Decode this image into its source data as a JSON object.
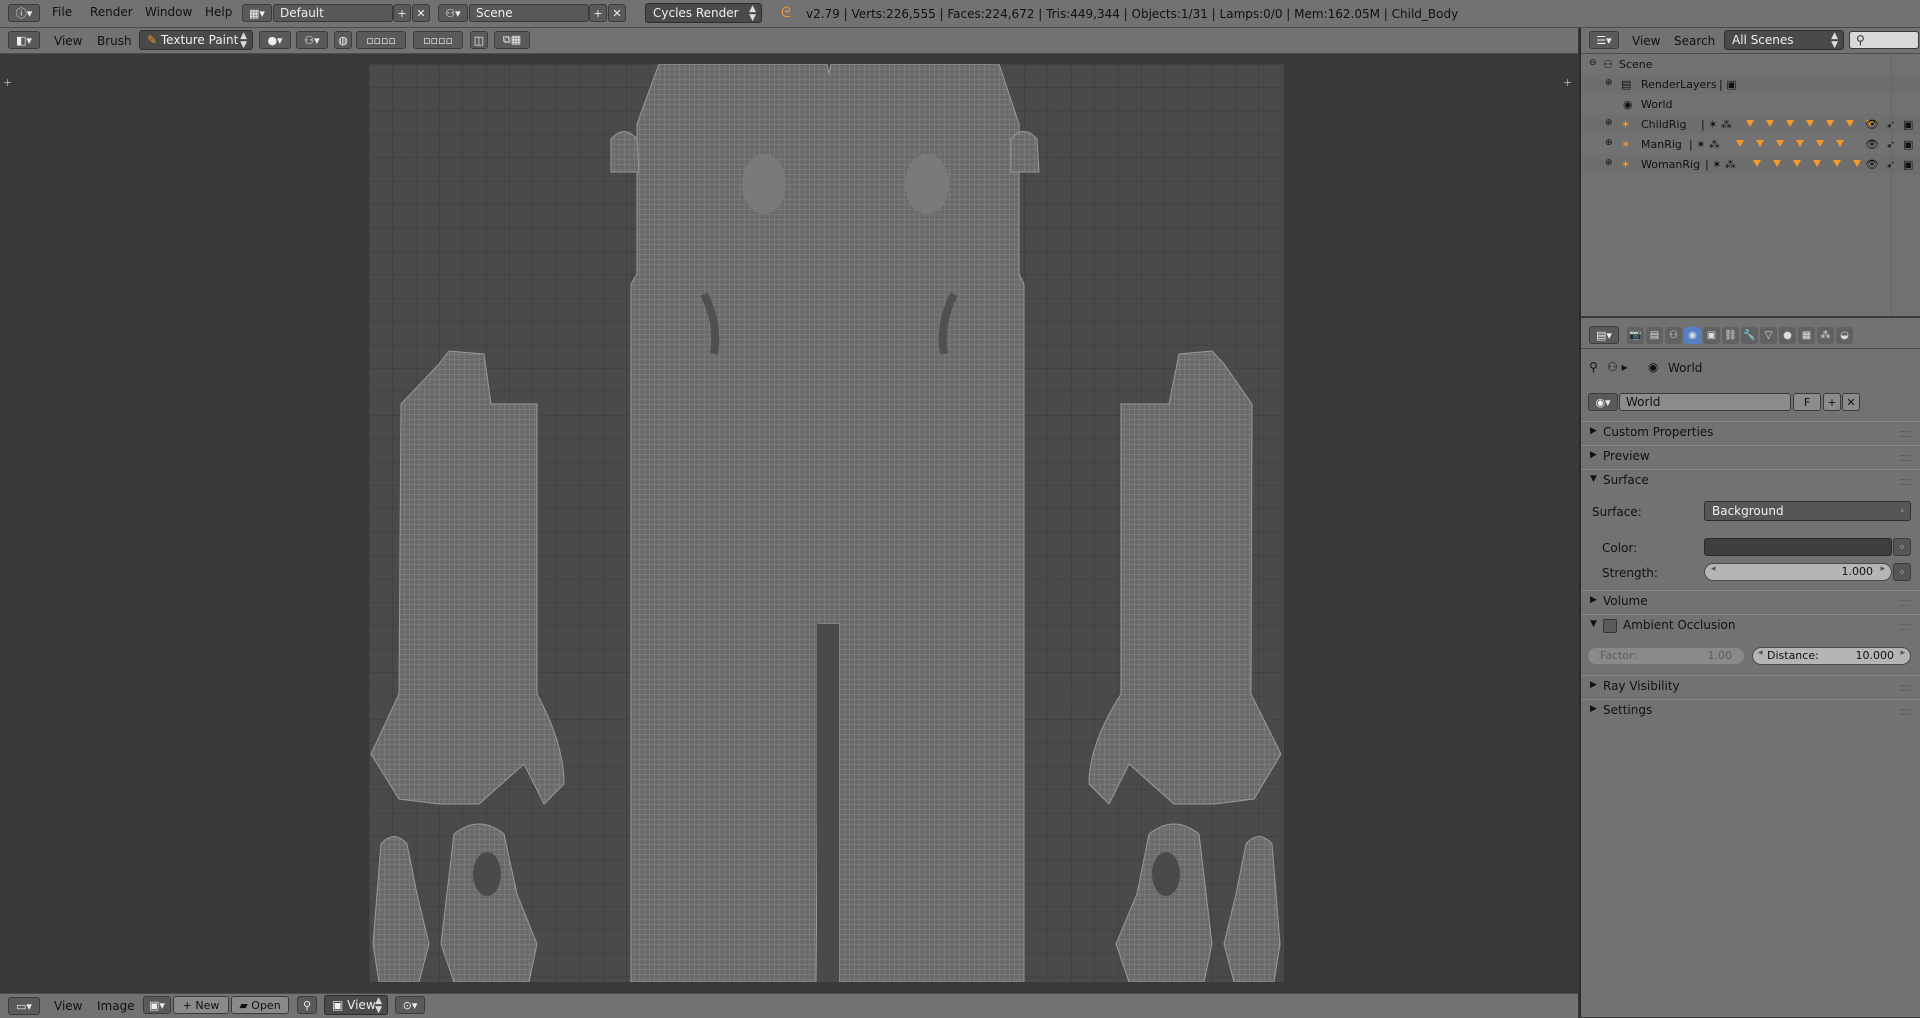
{
  "colors": {
    "bg": "#393939",
    "header": "#727272",
    "accent": "#f39a2b",
    "wire": "#8a8a8a"
  },
  "menu": {
    "file": "File",
    "render": "Render",
    "window": "Window",
    "help": "Help"
  },
  "layout": {
    "name": "Default",
    "scene": "Scene",
    "engine": "Cycles Render"
  },
  "stats": "v2.79 | Verts:226,555 | Faces:224,672 | Tris:449,344 | Objects:1/31 | Lamps:0/0 | Mem:162.05M | Child_Body",
  "editor_header": {
    "view": "View",
    "brush": "Brush",
    "mode": "Texture Paint"
  },
  "bottom_header": {
    "view": "View",
    "image": "Image",
    "new": "New",
    "open": "Open",
    "view2": "View"
  },
  "outliner_header": {
    "view": "View",
    "search": "Search",
    "scenes": "All Scenes"
  },
  "outliner": {
    "scene": "Scene",
    "items": [
      {
        "label": "RenderLayers"
      },
      {
        "label": "World"
      },
      {
        "label": "ChildRig"
      },
      {
        "label": "ManRig"
      },
      {
        "label": "WomanRig"
      }
    ]
  },
  "properties": {
    "breadcrumb": "World",
    "world_field": "World",
    "fake_user": "F",
    "panels": {
      "custom_properties": "Custom Properties",
      "preview": "Preview",
      "surface": "Surface",
      "volume": "Volume",
      "ambient_occlusion": "Ambient Occlusion",
      "ray_visibility": "Ray Visibility",
      "settings": "Settings"
    },
    "surface_label": "Surface:",
    "surface_value": "Background",
    "color_label": "Color:",
    "strength_label": "Strength:",
    "strength_value": "1.000",
    "factor_label": "Factor:",
    "factor_value": "1.00",
    "distance_label": "Distance:",
    "distance_value": "10.000"
  }
}
